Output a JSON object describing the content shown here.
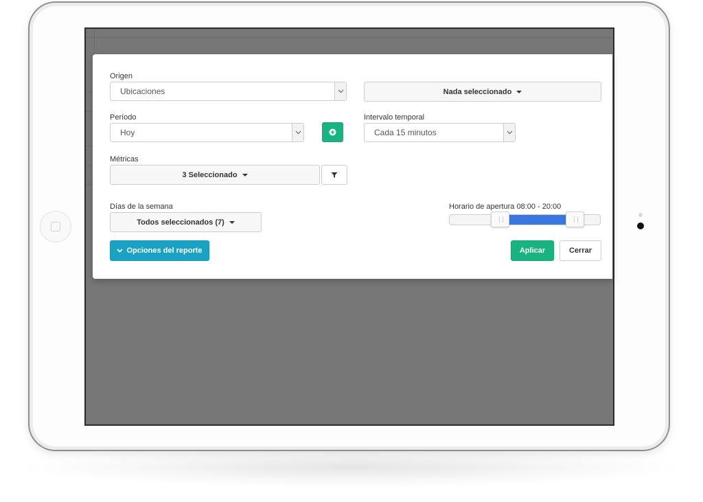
{
  "form": {
    "origin": {
      "label": "Origen",
      "value": "Ubicaciones"
    },
    "selection": {
      "label": "Nada seleccionado"
    },
    "period": {
      "label": "Período",
      "value": "Hoy"
    },
    "interval": {
      "label": "Intervalo temporal",
      "value": "Cada 15 minutos"
    },
    "metrics": {
      "label": "Métricas",
      "value": "3 Seleccionado"
    },
    "weekdays": {
      "label": "Días de la semana",
      "value": "Todos seleccionados (7)"
    },
    "opening_hours": {
      "label": "Horario de apertura 08:00 - 20:00",
      "start": "08:00",
      "end": "20:00",
      "range_min": "00:00",
      "range_max": "24:00"
    }
  },
  "buttons": {
    "report_options": "Opciones del reporte",
    "apply": "Aplicar",
    "close": "Cerrar"
  },
  "icons": {
    "add_period": "plus-circle-icon",
    "filter": "filter-icon",
    "report_options": "chevron-down-icon"
  },
  "colors": {
    "green": "#19b382",
    "teal": "#1aa2c4",
    "slider_range": "#3a78e0",
    "overlay": "#777777"
  }
}
